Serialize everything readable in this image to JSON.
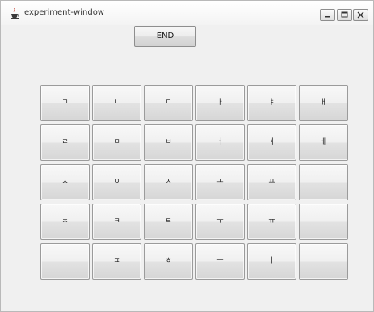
{
  "window": {
    "title": "experiment-window"
  },
  "end_button": {
    "label": "END"
  },
  "keys": [
    "ㄱ",
    "ㄴ",
    "ㄷ",
    "ㅏ",
    "ㅑ",
    "ㅐ",
    "ㄹ",
    "ㅁ",
    "ㅂ",
    "ㅓ",
    "ㅕ",
    "ㅔ",
    "ㅅ",
    "ㅇ",
    "ㅈ",
    "ㅗ",
    "ㅛ",
    "",
    "ㅊ",
    "ㅋ",
    "ㅌ",
    "ㅜ",
    "ㅠ",
    "",
    "",
    "ㅍ",
    "ㅎ",
    "ㅡ",
    "ㅣ",
    ""
  ],
  "colors": {
    "window_background": "#f0f0f0",
    "button_border": "#9b9b9b"
  }
}
